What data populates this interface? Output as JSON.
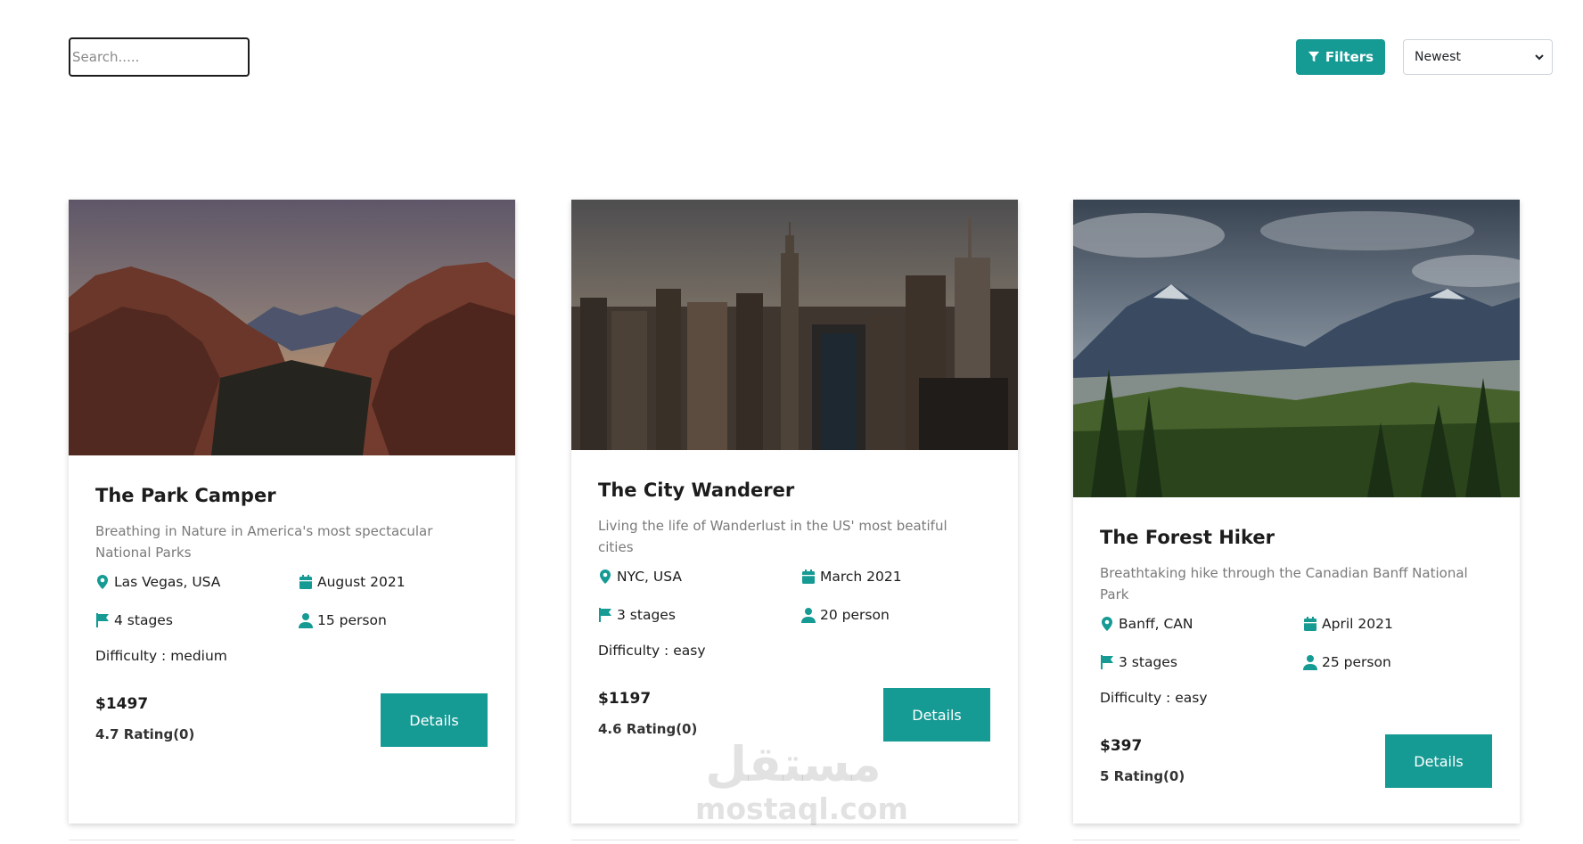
{
  "search": {
    "placeholder": "Search....."
  },
  "toolbar": {
    "filters_label": "Filters",
    "sort_selected": "Newest"
  },
  "colors": {
    "accent": "#159a94",
    "text": "#1c1c1c",
    "muted": "#7a7a7a"
  },
  "tours": [
    {
      "title": "The Park Camper",
      "description": "Breathing in Nature in America's most spectacular National Parks",
      "location": "Las Vegas, USA",
      "date": "August 2021",
      "stages": "4 stages",
      "people": "15 person",
      "difficulty": "Difficulty : medium",
      "price": "$1497",
      "rating": "4.7 Rating(0)",
      "button": "Details"
    },
    {
      "title": "The City Wanderer",
      "description": "Living the life of Wanderlust in the US' most beatiful cities",
      "location": "NYC, USA",
      "date": "March 2021",
      "stages": "3 stages",
      "people": "20 person",
      "difficulty": "Difficulty : easy",
      "price": "$1197",
      "rating": "4.6 Rating(0)",
      "button": "Details"
    },
    {
      "title": "The Forest Hiker",
      "description": "Breathtaking hike through the Canadian Banff National Park",
      "location": "Banff, CAN",
      "date": "April 2021",
      "stages": "3 stages",
      "people": "25 person",
      "difficulty": "Difficulty : easy",
      "price": "$397",
      "rating": "5 Rating(0)",
      "button": "Details"
    }
  ],
  "watermark": {
    "arabic": "مستقل",
    "latin": "mostaql.com"
  },
  "icons": {
    "filter": "filter-icon",
    "select": "chevron-down-icon",
    "location": "map-pin-icon",
    "date": "calendar-icon",
    "stages": "flag-icon",
    "people": "user-icon"
  }
}
